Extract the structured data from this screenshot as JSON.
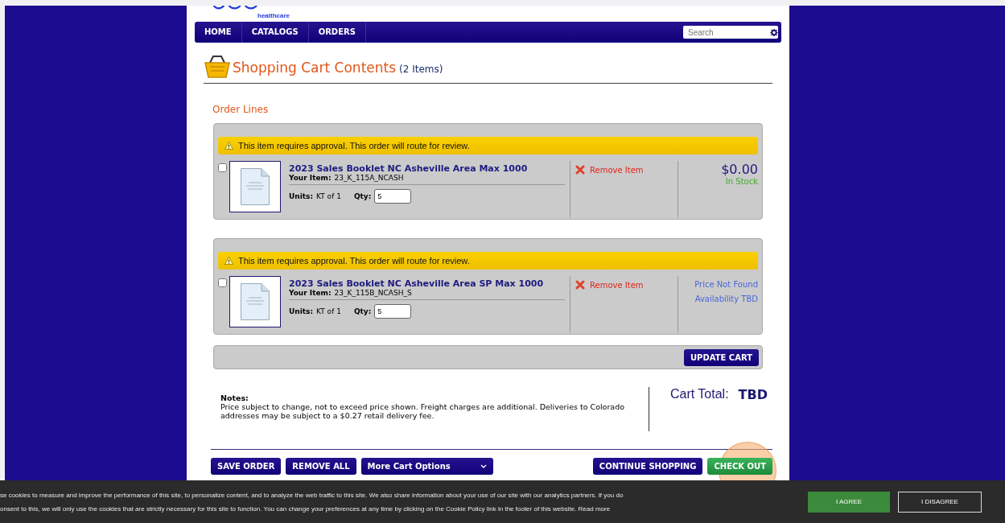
{
  "header": {
    "brand_sub": "healthcare"
  },
  "nav": {
    "items": [
      {
        "label": "HOME"
      },
      {
        "label": "CATALOGS"
      },
      {
        "label": "ORDERS"
      }
    ],
    "search": {
      "placeholder": "Search"
    }
  },
  "cart": {
    "title": "Shopping Cart Contents",
    "count": "(2 Items)",
    "section": "Order Lines",
    "items": [
      {
        "alert": "This item requires approval. This order will route for review.",
        "checked": false,
        "name": "2023 Sales Booklet NC Asheville Area Max 1000",
        "your_item_label": "Your Item:",
        "your_item": "23_K_115A_NCASH",
        "units_label": "Units:",
        "units": "KT of 1",
        "qty_label": "Qty:",
        "qty": "5",
        "remove": "Remove Item",
        "kind": "priced",
        "price": "$0.00",
        "stock": "In Stock"
      },
      {
        "alert": "This item requires approval. This order will route for review.",
        "checked": false,
        "name": "2023 Sales Booklet NC Asheville Area SP Max 1000",
        "your_item_label": "Your Item:",
        "your_item": "23_K_115B_NCASH_S",
        "units_label": "Units:",
        "units": "KT of 1",
        "qty_label": "Qty:",
        "qty": "5",
        "remove": "Remove Item",
        "kind": "unpriced",
        "price_note": "Price Not Found",
        "availability": "Availability TBD"
      }
    ],
    "update_button": "UPDATE CART",
    "notes_label": "Notes:",
    "notes": "Price subject to change, not to exceed price shown. Freight charges are additional. Deliveries to Colorado addresses may be subject to a $0.27 retail delivery fee.",
    "total_label": "Cart Total:",
    "total": "TBD",
    "left_buttons": [
      {
        "label": "SAVE ORDER",
        "kind": "button"
      },
      {
        "label": "REMOVE ALL",
        "kind": "button"
      },
      {
        "label": "More Cart Options",
        "kind": "dropdown"
      }
    ],
    "right_buttons": [
      {
        "label": "CONTINUE SHOPPING",
        "kind": "button"
      },
      {
        "label": "CHECK OUT",
        "kind": "primary"
      }
    ]
  },
  "cookie_banner": {
    "lines": [
      "se cookies to measure and improve the performance of this site, to personalize content, and to analyze the web traffic to this site. We also share information about your use of our site with our analytics partners. If you do",
      "onsent to this, we will only use the cookies that are strictly necessary for this site to function. You can change your preferences at any time by clicking on the Cookie Policy link in the footer of this website. Read more"
    ],
    "agree": "I AGREE",
    "disagree": "I DISAGREE"
  }
}
